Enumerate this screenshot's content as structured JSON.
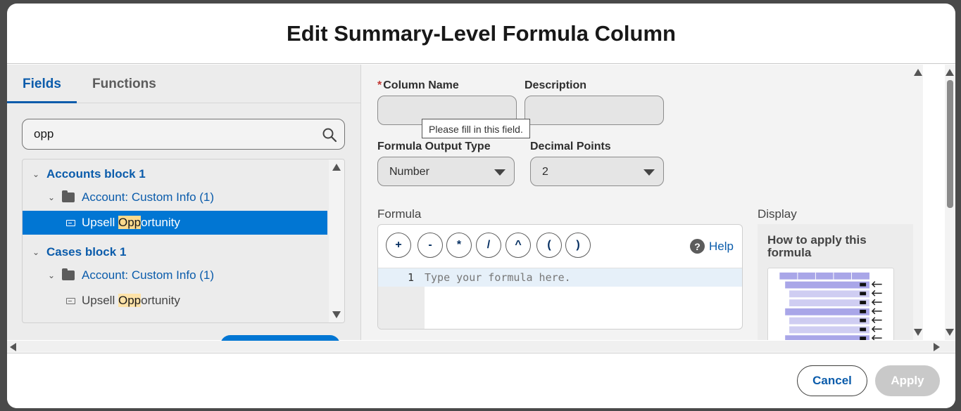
{
  "header": {
    "title": "Edit Summary-Level Formula Column"
  },
  "left": {
    "tabs": [
      {
        "label": "Fields",
        "active": true
      },
      {
        "label": "Functions",
        "active": false
      }
    ],
    "search": {
      "value": "opp"
    },
    "tree": [
      {
        "type": "block",
        "label": "Accounts block 1"
      },
      {
        "type": "group",
        "label": "Account: Custom Info (1)"
      },
      {
        "type": "field",
        "prefix": "Upsell ",
        "match": "Opp",
        "suffix": "ortunity",
        "selected": true
      },
      {
        "type": "block",
        "label": "Cases block 1"
      },
      {
        "type": "group",
        "label": "Account: Custom Info (1)"
      },
      {
        "type": "field",
        "prefix": "Upsell ",
        "match": "Opp",
        "suffix": "ortunity",
        "selected": false
      }
    ]
  },
  "form": {
    "column_name_label": "Column Name",
    "description_label": "Description",
    "tooltip": "Please fill in this field.",
    "output_type_label": "Formula Output Type",
    "output_type_value": "Number",
    "decimal_label": "Decimal Points",
    "decimal_value": "2",
    "formula_label": "Formula",
    "display_label": "Display",
    "operators": [
      "+",
      "-",
      "*",
      "/",
      "^",
      "(",
      ")"
    ],
    "help_label": "Help",
    "line_number": "1",
    "formula_placeholder": "Type your formula here.",
    "display_card_title": "How to apply this formula"
  },
  "footer": {
    "cancel_label": "Cancel",
    "apply_label": "Apply"
  },
  "colors": {
    "accent": "#0b5cab",
    "selected": "#0176d3",
    "highlight": "#fde2a8",
    "required": "#c23934"
  }
}
